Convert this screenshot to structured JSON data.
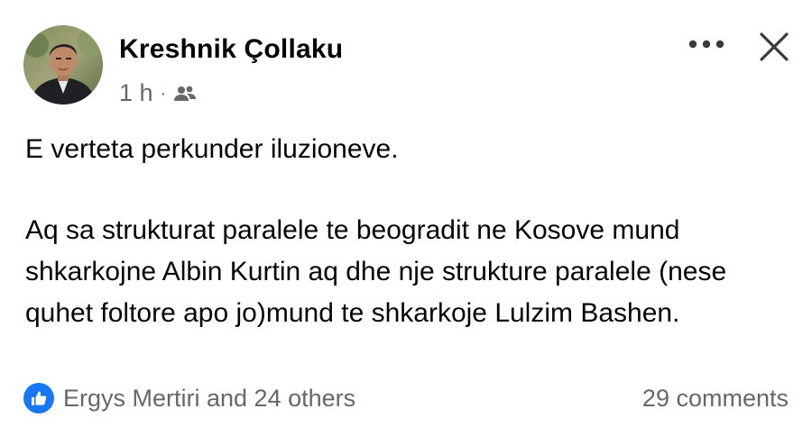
{
  "post": {
    "author": "Kreshnik Çollaku",
    "timestamp": "1 h",
    "separator": "·",
    "audience_icon": "friends-icon",
    "paragraphs": [
      "E verteta perkunder iluzioneve.",
      "Aq sa strukturat paralele te beogradit ne Kosove mund shkarkojne Albin Kurtin aq dhe nje strukture paralele (nese quhet foltore apo jo)mund te shkarkoje Lulzim Bashen."
    ]
  },
  "header_actions": {
    "more_icon": "more-horizontal-icon",
    "close_icon": "close-icon"
  },
  "footer": {
    "reaction_icon": "like-icon",
    "reactions_text": "Ergys Mertiri and 24 others",
    "comments_text": "29 comments"
  },
  "colors": {
    "primary_text": "#050505",
    "secondary_text": "#65676b",
    "like_blue": "#1877f2",
    "background": "#ffffff"
  }
}
